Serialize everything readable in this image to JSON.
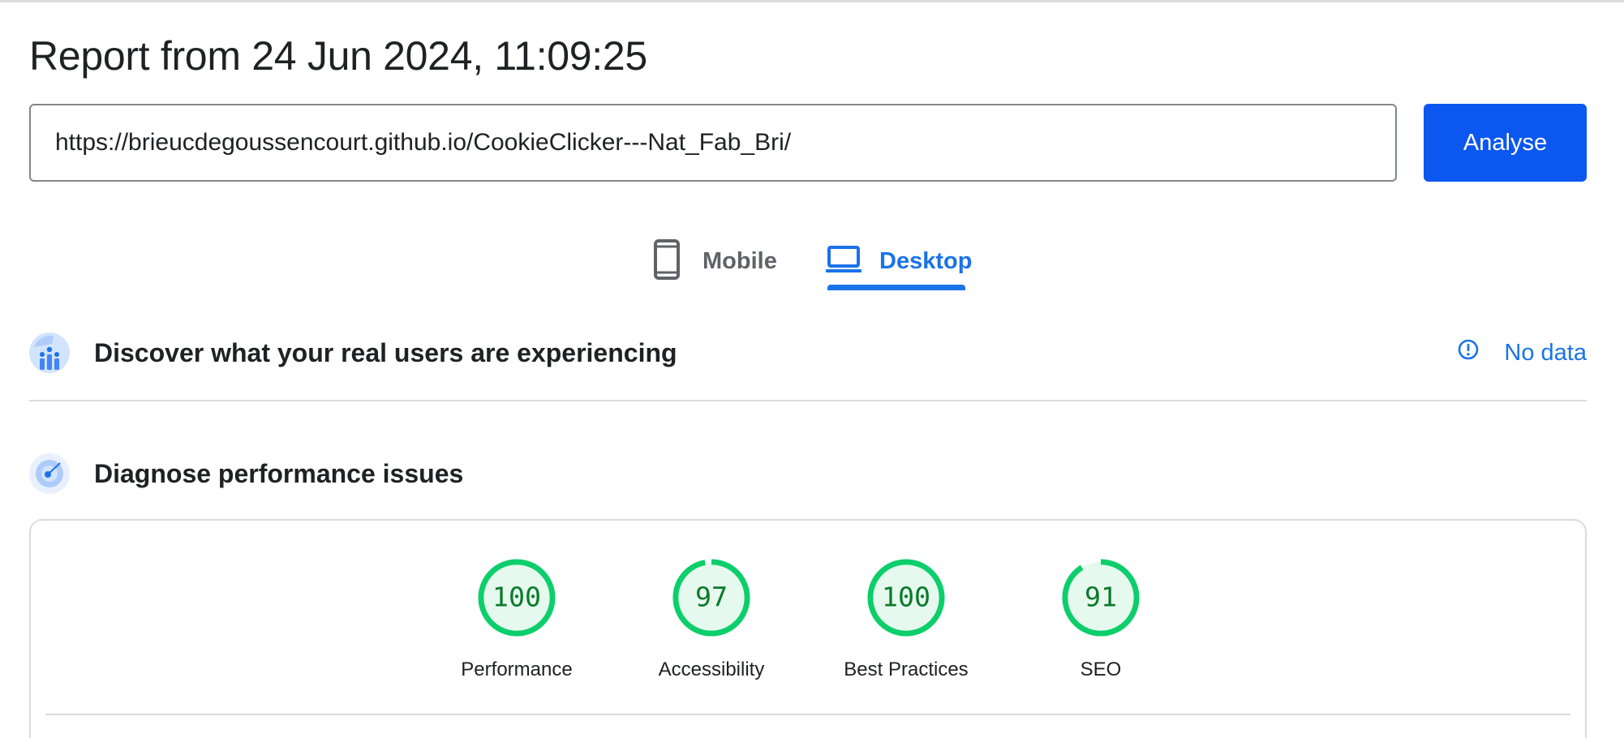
{
  "report": {
    "title": "Report from 24 Jun 2024, 11:09:25"
  },
  "url_field": {
    "value": "https://brieucdegoussencourt.github.io/CookieClicker---Nat_Fab_Bri/"
  },
  "analyse_button": {
    "label": "Analyse"
  },
  "device_tabs": {
    "mobile": {
      "label": "Mobile",
      "icon": "smartphone-icon"
    },
    "desktop": {
      "label": "Desktop",
      "icon": "laptop-icon",
      "selected": true
    }
  },
  "crux_section": {
    "title": "Discover what your real users are experiencing",
    "status": {
      "label": "No data",
      "icon": "info-icon"
    }
  },
  "diagnose_section": {
    "title": "Diagnose performance issues"
  },
  "scores": [
    {
      "value": 100,
      "label": "Performance"
    },
    {
      "value": 97,
      "label": "Accessibility"
    },
    {
      "value": 100,
      "label": "Best Practices"
    },
    {
      "value": 91,
      "label": "SEO"
    }
  ],
  "colors": {
    "accent": "#1a73e8",
    "button": "#0b57f0",
    "score_good_ring": "#0cce6b",
    "score_good_fill": "#e6f9ee",
    "score_good_text": "#0b7a2a"
  }
}
